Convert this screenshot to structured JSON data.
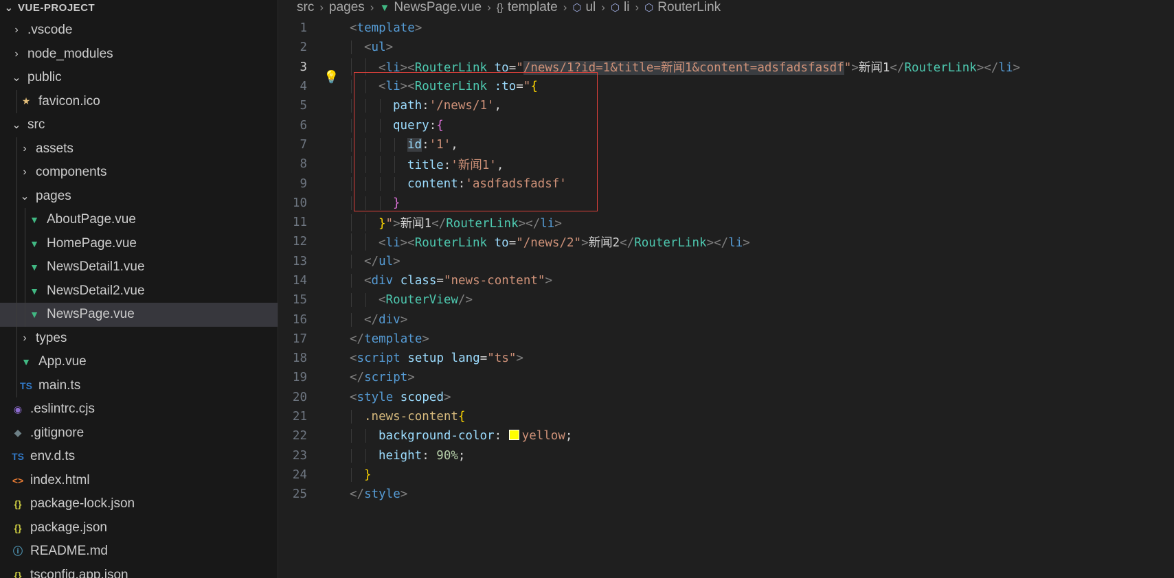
{
  "explorer": {
    "project_title": "VUE-PROJECT",
    "items": [
      {
        "label": ".vscode",
        "depth": 1,
        "kind": "folder",
        "expanded": false,
        "icon": "chevron-right-icon"
      },
      {
        "label": "node_modules",
        "depth": 1,
        "kind": "folder",
        "expanded": false,
        "icon": "chevron-right-icon"
      },
      {
        "label": "public",
        "depth": 1,
        "kind": "folder",
        "expanded": true,
        "icon": "chevron-down-icon"
      },
      {
        "label": "favicon.ico",
        "depth": 2,
        "kind": "file",
        "icon": "star-icon"
      },
      {
        "label": "src",
        "depth": 1,
        "kind": "folder",
        "expanded": true,
        "icon": "chevron-down-icon"
      },
      {
        "label": "assets",
        "depth": 2,
        "kind": "folder",
        "expanded": false,
        "icon": "chevron-right-icon"
      },
      {
        "label": "components",
        "depth": 2,
        "kind": "folder",
        "expanded": false,
        "icon": "chevron-right-icon"
      },
      {
        "label": "pages",
        "depth": 2,
        "kind": "folder",
        "expanded": true,
        "icon": "chevron-down-icon"
      },
      {
        "label": "AboutPage.vue",
        "depth": 3,
        "kind": "file",
        "icon": "vue-icon"
      },
      {
        "label": "HomePage.vue",
        "depth": 3,
        "kind": "file",
        "icon": "vue-icon"
      },
      {
        "label": "NewsDetail1.vue",
        "depth": 3,
        "kind": "file",
        "icon": "vue-icon"
      },
      {
        "label": "NewsDetail2.vue",
        "depth": 3,
        "kind": "file",
        "icon": "vue-icon"
      },
      {
        "label": "NewsPage.vue",
        "depth": 3,
        "kind": "file",
        "icon": "vue-icon",
        "selected": true
      },
      {
        "label": "types",
        "depth": 2,
        "kind": "folder",
        "expanded": false,
        "icon": "chevron-right-icon"
      },
      {
        "label": "App.vue",
        "depth": 2,
        "kind": "file",
        "icon": "vue-icon"
      },
      {
        "label": "main.ts",
        "depth": 2,
        "kind": "file",
        "icon": "ts-icon"
      },
      {
        "label": ".eslintrc.cjs",
        "depth": 1,
        "kind": "file",
        "icon": "eslint-icon"
      },
      {
        "label": ".gitignore",
        "depth": 1,
        "kind": "file",
        "icon": "git-icon"
      },
      {
        "label": "env.d.ts",
        "depth": 1,
        "kind": "file",
        "icon": "ts-icon"
      },
      {
        "label": "index.html",
        "depth": 1,
        "kind": "file",
        "icon": "html-icon"
      },
      {
        "label": "package-lock.json",
        "depth": 1,
        "kind": "file",
        "icon": "json-icon"
      },
      {
        "label": "package.json",
        "depth": 1,
        "kind": "file",
        "icon": "json-icon"
      },
      {
        "label": "README.md",
        "depth": 1,
        "kind": "file",
        "icon": "info-icon"
      },
      {
        "label": "tsconfig.app.json",
        "depth": 1,
        "kind": "file",
        "icon": "json-icon"
      }
    ]
  },
  "breadcrumb": {
    "parts": [
      "src",
      "pages",
      "NewsPage.vue",
      "template",
      "ul",
      "li",
      "RouterLink"
    ],
    "icons": [
      "",
      "",
      "vue-icon",
      "braces-icon",
      "cube-icon",
      "cube-icon",
      "cube-icon"
    ]
  },
  "editor": {
    "active_line": 3,
    "lines": [
      {
        "n": "1",
        "indent": 0,
        "tokens": [
          [
            "p",
            "<"
          ],
          [
            "tag",
            "template"
          ],
          [
            "p",
            ">"
          ]
        ]
      },
      {
        "n": "2",
        "indent": 1,
        "tokens": [
          [
            "p",
            "<"
          ],
          [
            "tag",
            "ul"
          ],
          [
            "p",
            ">"
          ]
        ]
      },
      {
        "n": "3",
        "indent": 2,
        "bulb": true,
        "tokens": [
          [
            "p",
            "<"
          ],
          [
            "tag",
            "li"
          ],
          [
            "p",
            "><"
          ],
          [
            "comp",
            "RouterLink"
          ],
          [
            "txt",
            " "
          ],
          [
            "attr",
            "to"
          ],
          [
            "txt",
            "="
          ],
          [
            "str",
            "\""
          ],
          [
            "strhl",
            "/news/1?id=1&title=新闻1&content=adsfadsfasdf"
          ],
          [
            "str",
            "\""
          ],
          [
            "p",
            ">"
          ],
          [
            "txt",
            "新闻1"
          ],
          [
            "p",
            "</"
          ],
          [
            "comp",
            "RouterLink"
          ],
          [
            "p",
            "></"
          ],
          [
            "tag",
            "li"
          ],
          [
            "p",
            ">"
          ]
        ]
      },
      {
        "n": "4",
        "indent": 2,
        "tokens": [
          [
            "p",
            "<"
          ],
          [
            "tag",
            "li"
          ],
          [
            "p",
            "><"
          ],
          [
            "comp",
            "RouterLink"
          ],
          [
            "txt",
            " "
          ],
          [
            "attr",
            ":to"
          ],
          [
            "txt",
            "="
          ],
          [
            "str",
            "\""
          ],
          [
            "brace",
            "{"
          ]
        ]
      },
      {
        "n": "5",
        "indent": 3,
        "tokens": [
          [
            "prop",
            "path"
          ],
          [
            "txt",
            ":"
          ],
          [
            "str",
            "'/news/1'"
          ],
          [
            "txt",
            ","
          ]
        ]
      },
      {
        "n": "6",
        "indent": 3,
        "tokens": [
          [
            "prop",
            "query"
          ],
          [
            "txt",
            ":"
          ],
          [
            "brace2",
            "{"
          ]
        ]
      },
      {
        "n": "7",
        "indent": 4,
        "tokens": [
          [
            "prophl",
            "id"
          ],
          [
            "txt",
            ":"
          ],
          [
            "str",
            "'1'"
          ],
          [
            "txt",
            ","
          ]
        ]
      },
      {
        "n": "8",
        "indent": 4,
        "tokens": [
          [
            "prop",
            "title"
          ],
          [
            "txt",
            ":"
          ],
          [
            "str",
            "'新闻1'"
          ],
          [
            "txt",
            ","
          ]
        ]
      },
      {
        "n": "9",
        "indent": 4,
        "tokens": [
          [
            "prop",
            "content"
          ],
          [
            "txt",
            ":"
          ],
          [
            "str",
            "'asdfadsfadsf'"
          ]
        ]
      },
      {
        "n": "10",
        "indent": 3,
        "tokens": [
          [
            "brace2",
            "}"
          ]
        ]
      },
      {
        "n": "11",
        "indent": 2,
        "tokens": [
          [
            "brace",
            "}"
          ],
          [
            "str",
            "\""
          ],
          [
            "p",
            ">"
          ],
          [
            "txt",
            "新闻1"
          ],
          [
            "p",
            "</"
          ],
          [
            "comp",
            "RouterLink"
          ],
          [
            "p",
            "></"
          ],
          [
            "tag",
            "li"
          ],
          [
            "p",
            ">"
          ]
        ]
      },
      {
        "n": "12",
        "indent": 2,
        "tokens": [
          [
            "p",
            "<"
          ],
          [
            "tag",
            "li"
          ],
          [
            "p",
            "><"
          ],
          [
            "comp",
            "RouterLink"
          ],
          [
            "txt",
            " "
          ],
          [
            "attr",
            "to"
          ],
          [
            "txt",
            "="
          ],
          [
            "str",
            "\"/news/2\""
          ],
          [
            "p",
            ">"
          ],
          [
            "txt",
            "新闻2"
          ],
          [
            "p",
            "</"
          ],
          [
            "comp",
            "RouterLink"
          ],
          [
            "p",
            "></"
          ],
          [
            "tag",
            "li"
          ],
          [
            "p",
            ">"
          ]
        ]
      },
      {
        "n": "13",
        "indent": 1,
        "tokens": [
          [
            "p",
            "</"
          ],
          [
            "tag",
            "ul"
          ],
          [
            "p",
            ">"
          ]
        ]
      },
      {
        "n": "14",
        "indent": 1,
        "tokens": [
          [
            "p",
            "<"
          ],
          [
            "tag",
            "div"
          ],
          [
            "txt",
            " "
          ],
          [
            "attr",
            "class"
          ],
          [
            "txt",
            "="
          ],
          [
            "str",
            "\"news-content\""
          ],
          [
            "p",
            ">"
          ]
        ]
      },
      {
        "n": "15",
        "indent": 2,
        "tokens": [
          [
            "p",
            "<"
          ],
          [
            "comp",
            "RouterView"
          ],
          [
            "p",
            "/>"
          ]
        ]
      },
      {
        "n": "16",
        "indent": 1,
        "tokens": [
          [
            "p",
            "</"
          ],
          [
            "tag",
            "div"
          ],
          [
            "p",
            ">"
          ]
        ]
      },
      {
        "n": "17",
        "indent": 0,
        "tokens": [
          [
            "p",
            "</"
          ],
          [
            "tag",
            "template"
          ],
          [
            "p",
            ">"
          ]
        ]
      },
      {
        "n": "18",
        "indent": 0,
        "tokens": [
          [
            "p",
            "<"
          ],
          [
            "tag",
            "script"
          ],
          [
            "txt",
            " "
          ],
          [
            "attr",
            "setup"
          ],
          [
            "txt",
            " "
          ],
          [
            "attr",
            "lang"
          ],
          [
            "txt",
            "="
          ],
          [
            "str",
            "\"ts\""
          ],
          [
            "p",
            ">"
          ]
        ]
      },
      {
        "n": "19",
        "indent": 0,
        "tokens": [
          [
            "p",
            "</"
          ],
          [
            "tag",
            "script"
          ],
          [
            "p",
            ">"
          ]
        ]
      },
      {
        "n": "20",
        "indent": 0,
        "tokens": [
          [
            "p",
            "<"
          ],
          [
            "tag",
            "style"
          ],
          [
            "txt",
            " "
          ],
          [
            "attr",
            "scoped"
          ],
          [
            "p",
            ">"
          ]
        ]
      },
      {
        "n": "21",
        "indent": 1,
        "tokens": [
          [
            "sel",
            ".news-content"
          ],
          [
            "brace",
            "{"
          ]
        ]
      },
      {
        "n": "22",
        "indent": 2,
        "tokens": [
          [
            "prop",
            "background-color"
          ],
          [
            "txt",
            ": "
          ],
          [
            "swatch",
            ""
          ],
          [
            "str",
            "yellow"
          ],
          [
            "txt",
            ";"
          ]
        ]
      },
      {
        "n": "23",
        "indent": 2,
        "tokens": [
          [
            "prop",
            "height"
          ],
          [
            "txt",
            ": "
          ],
          [
            "num",
            "90%"
          ],
          [
            "txt",
            ";"
          ]
        ]
      },
      {
        "n": "24",
        "indent": 1,
        "tokens": [
          [
            "brace",
            "}"
          ]
        ]
      },
      {
        "n": "25",
        "indent": 0,
        "tokens": [
          [
            "p",
            "</"
          ],
          [
            "tag",
            "style"
          ],
          [
            "p",
            ">"
          ]
        ]
      }
    ]
  },
  "colors": {
    "highlight_box": "#e0413b",
    "vue_icon": "#41b883",
    "swatch_yellow": "#ffff00"
  }
}
